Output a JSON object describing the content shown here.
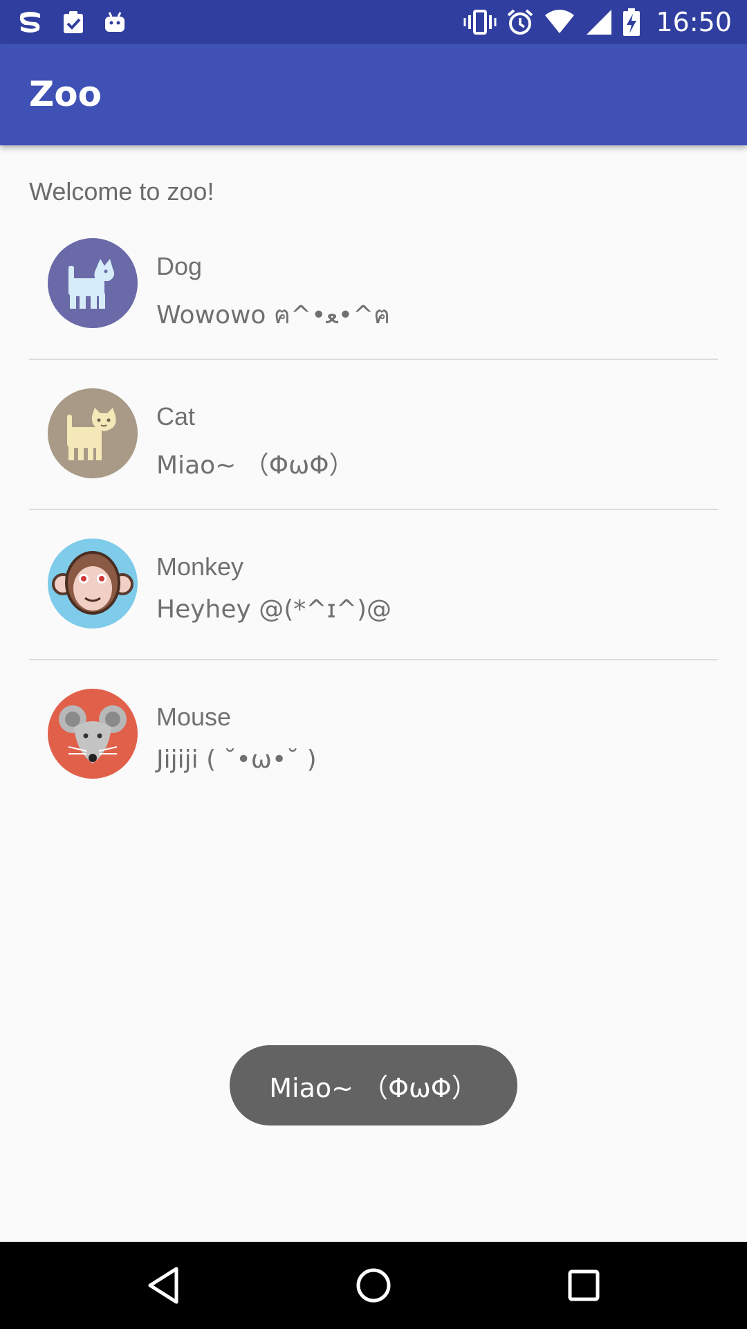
{
  "status_bar": {
    "time": "16:50",
    "left_icons": [
      "s-app-icon",
      "clipboard-check-icon",
      "android-robot-icon"
    ],
    "right_icons": [
      "vibrate-icon",
      "alarm-icon",
      "wifi-icon",
      "signal-icon",
      "battery-charging-icon"
    ]
  },
  "app_bar": {
    "title": "Zoo"
  },
  "welcome_text": "Welcome to zoo!",
  "animals": [
    {
      "name": "Dog",
      "sound": "Wowowo ฅ^•ﻌ•^ฅ",
      "avatar_color": "#6a6aa8",
      "icon": "dog-icon"
    },
    {
      "name": "Cat",
      "sound": "Miao~ （ΦωΦ）",
      "avatar_color": "#a89a86",
      "icon": "cat-icon"
    },
    {
      "name": "Monkey",
      "sound": "Heyhey @(*^ɪ^)@",
      "avatar_color": "#7ecbea",
      "icon": "monkey-icon"
    },
    {
      "name": "Mouse",
      "sound": "Jijiji ( ˘•ω•˘ )",
      "avatar_color": "#e0604a",
      "icon": "mouse-icon"
    }
  ],
  "toast": {
    "text": "Miao~ （ΦωΦ）"
  },
  "nav_bar": {
    "buttons": [
      "back-icon",
      "home-icon",
      "recents-icon"
    ]
  },
  "colors": {
    "status_bar": "#303f9f",
    "app_bar": "#3f51b5",
    "background": "#fafafa",
    "toast": "#636363"
  }
}
